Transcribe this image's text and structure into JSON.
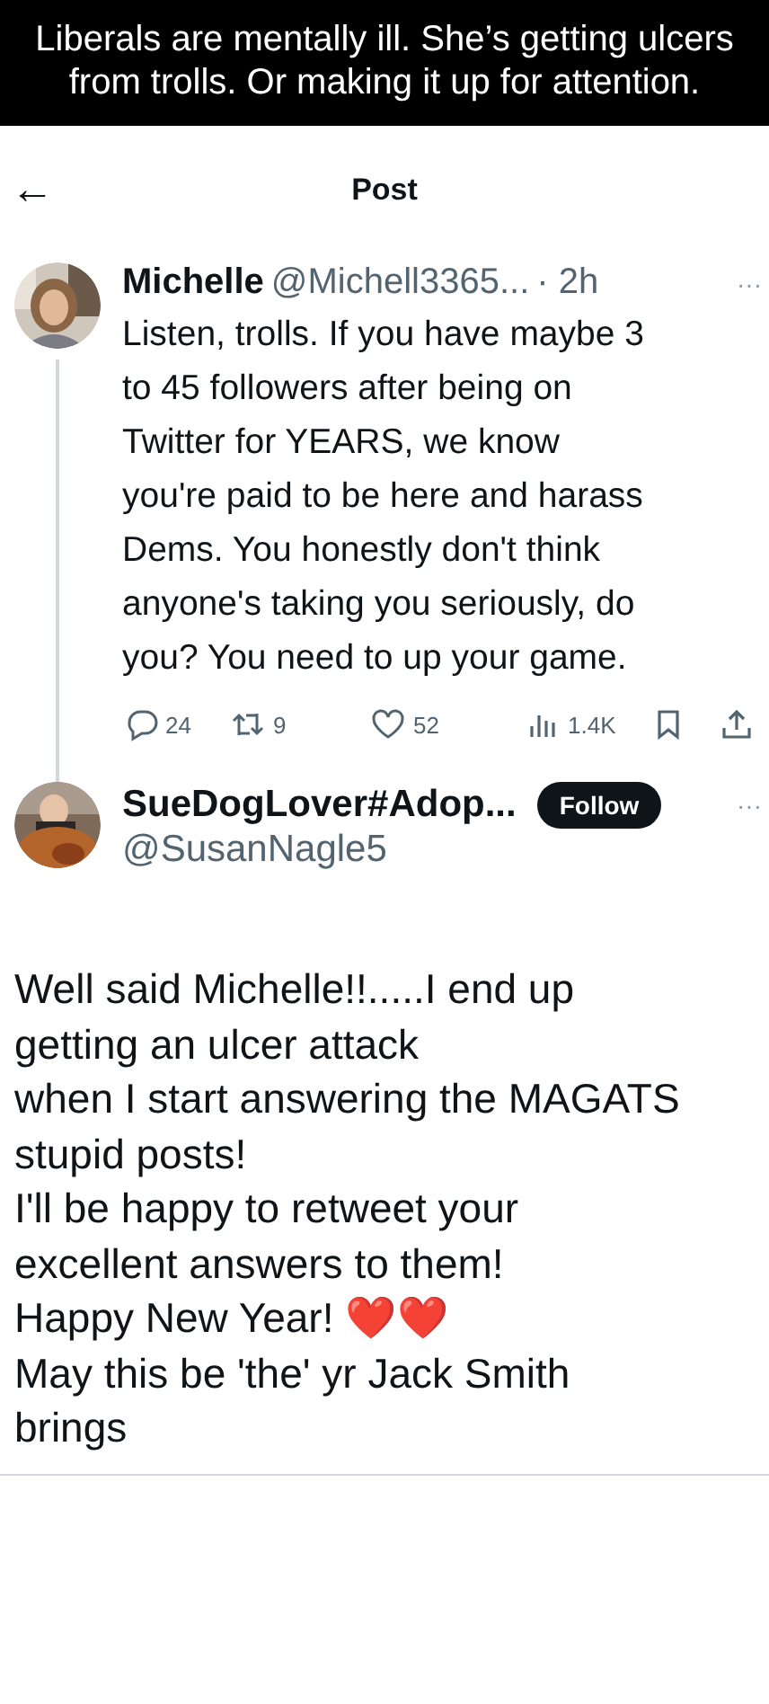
{
  "caption": "Liberals are mentally ill. She’s getting ulcers from trolls. Or making it up for attention.",
  "header": {
    "back": "←",
    "title": "Post"
  },
  "post": {
    "name": "Michelle",
    "handle": "@Michell3365...",
    "time": "· 2h",
    "more": "···",
    "text": "Listen, trolls.  If you have maybe 3\nto 45 followers after being on\nTwitter for YEARS, we know\nyou're paid to be here and harass\nDems.  You honestly don't think\nanyone's taking you seriously, do\nyou?  You need to up your game.",
    "actions": [
      {
        "kind": "reply",
        "count": "24"
      },
      {
        "kind": "repost",
        "count": "9"
      },
      {
        "kind": "like",
        "count": "52"
      },
      {
        "kind": "views",
        "count": "1.4K"
      },
      {
        "kind": "bookmark"
      },
      {
        "kind": "share"
      }
    ]
  },
  "reply": {
    "name": "SueDogLover#Adop...",
    "handle": "@SusanNagle5",
    "follow": "Follow",
    "more": "···",
    "text": "Well said Michelle!!.....I end up\ngetting an ulcer attack\nwhen I start answering the MAGATS\nstupid posts!\nI'll be happy to retweet your\nexcellent answers to them!\nHappy New Year! ❤️❤️\nMay this be 'the' yr Jack Smith\nbrings"
  }
}
